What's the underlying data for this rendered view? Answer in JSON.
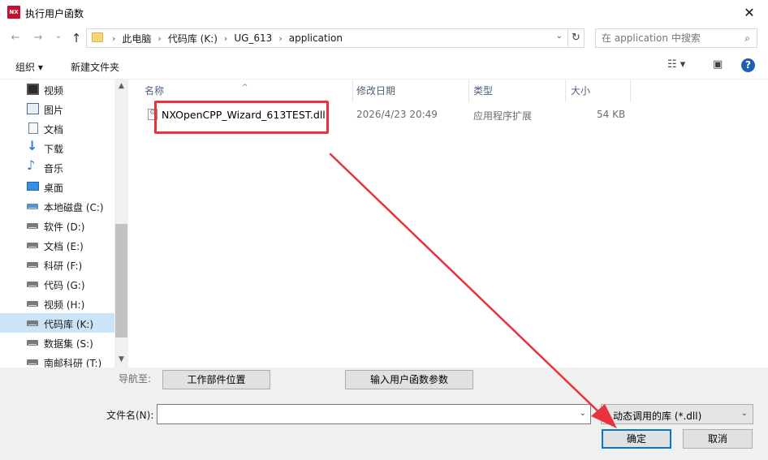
{
  "window": {
    "title": "执行用户函数",
    "app_icon_label": "NX",
    "close_glyph": "✕"
  },
  "nav": {
    "back_glyph": "←",
    "forward_glyph": "→",
    "recent_glyph": "⌄",
    "up_glyph": "↑"
  },
  "address": {
    "crumbs": [
      "此电脑",
      "代码库 (K:)",
      "UG_613",
      "application"
    ],
    "separator": "›",
    "dropdown_glyph": "⌄",
    "refresh_glyph": "↻"
  },
  "search": {
    "placeholder": "在 application 中搜索",
    "icon_glyph": "⌕"
  },
  "toolbar": {
    "organize": "组织 ▾",
    "new_folder": "新建文件夹",
    "view_glyph": "☷ ▾",
    "preview_glyph": "▣",
    "help_glyph": "?"
  },
  "sidebar": {
    "items": [
      {
        "label": "视频",
        "icon": "video-icon"
      },
      {
        "label": "图片",
        "icon": "pictures-icon"
      },
      {
        "label": "文档",
        "icon": "documents-icon"
      },
      {
        "label": "下载",
        "icon": "download-icon"
      },
      {
        "label": "音乐",
        "icon": "music-icon"
      },
      {
        "label": "桌面",
        "icon": "desktop-icon"
      },
      {
        "label": "本地磁盘 (C:)",
        "icon": "system-drive-icon"
      },
      {
        "label": "软件 (D:)",
        "icon": "drive-icon"
      },
      {
        "label": "文档 (E:)",
        "icon": "drive-icon"
      },
      {
        "label": "科研 (F:)",
        "icon": "drive-icon"
      },
      {
        "label": "代码 (G:)",
        "icon": "drive-icon"
      },
      {
        "label": "视频 (H:)",
        "icon": "drive-icon"
      },
      {
        "label": "代码库 (K:)",
        "icon": "drive-icon",
        "selected": true
      },
      {
        "label": "数据集 (S:)",
        "icon": "drive-icon"
      },
      {
        "label": "南邮科研 (T:)",
        "icon": "drive-icon"
      }
    ],
    "scroll_up_glyph": "▲",
    "scroll_down_glyph": "▼"
  },
  "columns": {
    "name": "名称",
    "modified": "修改日期",
    "type": "类型",
    "size": "大小",
    "sort_glyph": "^"
  },
  "files": [
    {
      "name": "NXOpenCPP_Wizard_613TEST.dll",
      "modified": "2026/4/23 20:49",
      "type": "应用程序扩展",
      "size": "54 KB"
    }
  ],
  "bottom": {
    "navigate_label": "导航至:",
    "btn_workpart": "工作部件位置",
    "btn_params": "输入用户函数参数",
    "filename_label": "文件名(N):",
    "filename_value": "",
    "filetype_value": "动态调用的库 (*.dll)",
    "filetype_dropdown_glyph": "⌄",
    "ok": "确定",
    "cancel": "取消"
  },
  "colors": {
    "annotation_red": "#e8323d",
    "selection_blue": "#cce4f7",
    "focus_blue": "#0078d7"
  }
}
